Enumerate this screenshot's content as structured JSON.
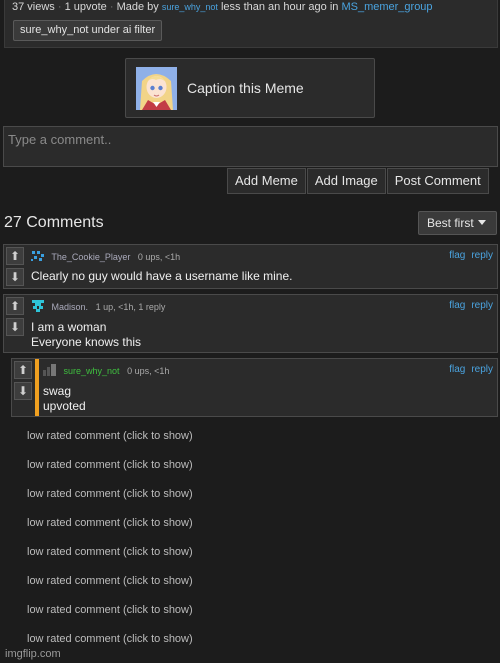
{
  "post_meta": {
    "views": "37 views",
    "sep1": "·",
    "upvotes": "1 upvote",
    "sep2": "·",
    "made_by": "Made by",
    "author": "sure_why_not",
    "time": "less than an hour ago in",
    "stream": "MS_memer_group"
  },
  "tag": "sure_why_not under ai filter",
  "caption_button": {
    "label": "Caption this Meme"
  },
  "comment_box": {
    "placeholder": "Type a comment.."
  },
  "actions": {
    "add_meme": "Add Meme",
    "add_image": "Add Image",
    "post_comment": "Post Comment"
  },
  "comments_header": {
    "count": "27 Comments",
    "sort": "Best first"
  },
  "icons": {
    "upvote": "arrow-up-icon",
    "downvote": "arrow-down-icon"
  },
  "comments": [
    {
      "author": "The_Cookie_Player",
      "stats": "0 ups, <1h",
      "flag": "flag",
      "reply": "reply",
      "lines": [
        "Clearly no guy would have a username like mine."
      ]
    },
    {
      "author": "Madison.",
      "stats": "1 up, <1h, 1 reply",
      "flag": "flag",
      "reply": "reply",
      "lines": [
        "I am a woman",
        "Everyone knows this"
      ]
    },
    {
      "author": "sure_why_not",
      "stats": "0 ups, <1h",
      "flag": "flag",
      "reply": "reply",
      "lines": [
        "swag",
        "upvoted"
      ]
    }
  ],
  "low_rated": [
    "low rated comment (click to show)",
    "low rated comment (click to show)",
    "low rated comment (click to show)",
    "low rated comment (click to show)",
    "low rated comment (click to show)",
    "low rated comment (click to show)",
    "low rated comment (click to show)",
    "low rated comment (click to show)"
  ],
  "watermark": "imgflip.com",
  "colors": {
    "background": "#1c1c1c",
    "link": "#4aa3df",
    "op_accent": "#f0a020",
    "op_name": "#3fbf3f"
  }
}
